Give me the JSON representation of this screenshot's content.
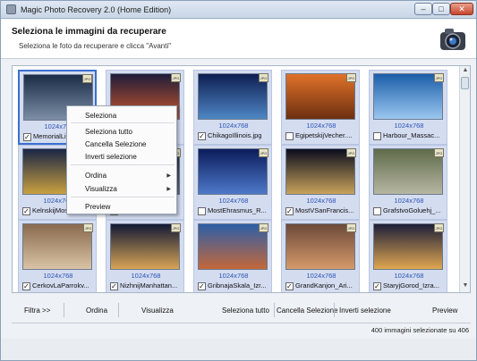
{
  "window": {
    "title": "Magic Photo Recovery 2.0 (Home Edition)",
    "controls": {
      "minimize": "–",
      "maximize": "□",
      "close": "✕"
    }
  },
  "header": {
    "title": "Seleziona le immagini da recuperare",
    "subtitle": "Seleziona le foto da recuperare e clicca \"Avanti\""
  },
  "tiles": [
    {
      "resolution": "1024x768",
      "caption": "MemorialLink",
      "checked": true,
      "focused": true,
      "colors": [
        "#1b2c48",
        "#7d8ea6"
      ]
    },
    {
      "resolution": "1024x768",
      "caption": "",
      "checked": false,
      "focused": false,
      "colors": [
        "#1f1c3a",
        "#c9572c"
      ]
    },
    {
      "resolution": "1024x768",
      "caption": "ChikagoIllinois.jpg",
      "checked": true,
      "focused": false,
      "colors": [
        "#0e1f52",
        "#4f86c6"
      ]
    },
    {
      "resolution": "1024x768",
      "caption": "EgipetskijVecher....",
      "checked": false,
      "focused": false,
      "colors": [
        "#e0722a",
        "#6d2f10"
      ]
    },
    {
      "resolution": "1024x768",
      "caption": "Harbour_Massac...",
      "checked": false,
      "focused": false,
      "colors": [
        "#1b5ea8",
        "#9cc7f0"
      ]
    },
    {
      "resolution": "1024x768",
      "caption": "KelnskijMost_",
      "checked": true,
      "focused": false,
      "colors": [
        "#1a2646",
        "#c9a040"
      ]
    },
    {
      "resolution": "1024x768",
      "caption": "",
      "checked": false,
      "focused": false,
      "colors": [
        "#2b2b3a",
        "#6a6f82"
      ]
    },
    {
      "resolution": "1024x768",
      "caption": "MostEhrasmus_R...",
      "checked": false,
      "focused": false,
      "colors": [
        "#0c1c5c",
        "#4d79c9"
      ]
    },
    {
      "resolution": "1024x768",
      "caption": "MostVSanFrancis...",
      "checked": true,
      "focused": false,
      "colors": [
        "#0a0d1e",
        "#c9a35a"
      ]
    },
    {
      "resolution": "1024x768",
      "caption": "GrafstvoGoluehj_...",
      "checked": false,
      "focused": false,
      "colors": [
        "#5f6b4a",
        "#b7b6a2"
      ]
    },
    {
      "resolution": "1024x768",
      "caption": "CerkovLaParrokv...",
      "checked": true,
      "focused": false,
      "colors": [
        "#8a6a4e",
        "#d9c3a6"
      ]
    },
    {
      "resolution": "1024x768",
      "caption": "NizhnijManhattan...",
      "checked": true,
      "focused": false,
      "colors": [
        "#121a36",
        "#d8a455"
      ]
    },
    {
      "resolution": "1024x768",
      "caption": "GribnajaSkala_Izr...",
      "checked": true,
      "focused": false,
      "colors": [
        "#2d5fa8",
        "#c4683a"
      ]
    },
    {
      "resolution": "1024x768",
      "caption": "GrandKanjon_Ari...",
      "checked": true,
      "focused": false,
      "colors": [
        "#6d4a3a",
        "#d59a6a"
      ]
    },
    {
      "resolution": "1024x768",
      "caption": "StaryjGorod_Izra...",
      "checked": true,
      "focused": false,
      "colors": [
        "#1d1f3a",
        "#e0a750"
      ]
    }
  ],
  "badge_text": "JPG",
  "context_menu": {
    "items": [
      {
        "label": "Seleziona",
        "submenu": false
      },
      {
        "label": "Seleziona tutto",
        "submenu": false
      },
      {
        "label": "Cancella Selezione",
        "submenu": false
      },
      {
        "label": "Inverti selezione",
        "submenu": false
      },
      {
        "label": "Ordina",
        "submenu": true
      },
      {
        "label": "Visualizza",
        "submenu": true
      },
      {
        "label": "Preview",
        "submenu": false
      }
    ]
  },
  "toolbar": {
    "filter": "Filtra >>",
    "sort": "Ordina",
    "view": "Visualizza",
    "select_all": "Seleziona tutto",
    "clear_selection": "Cancella Selezione",
    "invert_selection": "Inverti selezione",
    "preview": "Preview"
  },
  "status": {
    "text": "400 immagini selezionate su 406"
  }
}
